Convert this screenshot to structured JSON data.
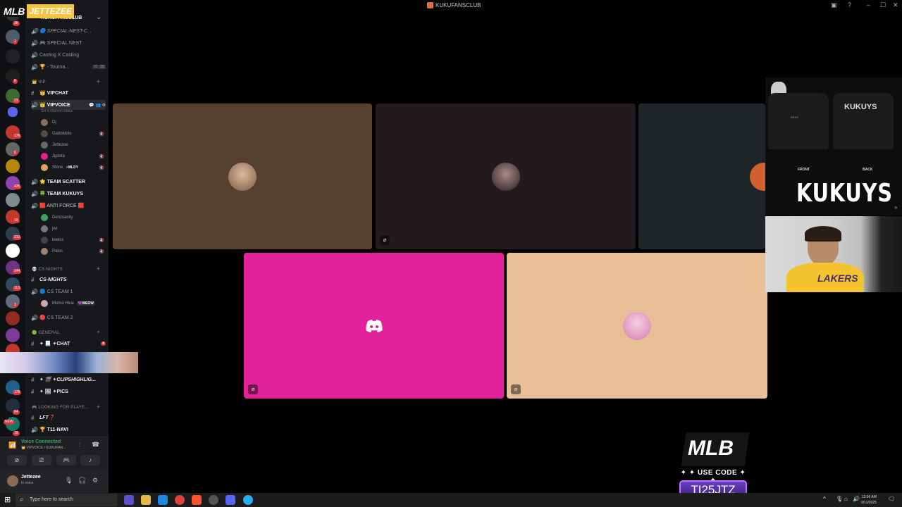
{
  "window": {
    "title": "KUKUFANSCLUB"
  },
  "overlay_logo": {
    "mlb": "MLB",
    "name": "JETTEZEE"
  },
  "server": {
    "name": "KUKUFANSCLUB"
  },
  "channels_top": [
    {
      "label": "🔵 SPECIAL-NEST-C...",
      "icon": "🔊",
      "style": "italic"
    },
    {
      "label": "🎮 SPECIAL NEST",
      "icon": "🔊"
    },
    {
      "label": "Casting X Casting",
      "icon": "🔊"
    },
    {
      "label": "🏆 - Tourna...",
      "icon": "🔊",
      "count_a": "00",
      "count_b": "05"
    }
  ],
  "category_vip": "👑 VIP",
  "vip_chat": "👑 VIPCHAT",
  "vip_voice": "👑 VIPVOICE",
  "channel_status": "Set a channel status",
  "vip_users": [
    {
      "name": "Dj",
      "color": "#8b6e5a"
    },
    {
      "name": "Gabbldoto",
      "color": "#5b4a3c"
    },
    {
      "name": "Jettezee",
      "color": "#6a6a6a"
    },
    {
      "name": "Jgdota",
      "color": "#e91e8c"
    },
    {
      "name": "Shine",
      "color": "#d9a06a",
      "tag": "⚡MLDY"
    }
  ],
  "team_channels": [
    {
      "label": "🌟 TEAM SCATTER"
    },
    {
      "label": "🍀 TEAM KUKUYS"
    },
    {
      "label": "🟥 ANTI FORCE 🟥"
    }
  ],
  "anti_users": [
    {
      "name": "Denzsanity",
      "color": "#3ba55d"
    },
    {
      "name": "jwl",
      "color": "#777"
    },
    {
      "name": "lewiss",
      "color": "#444"
    },
    {
      "name": "Palos",
      "color": "#a08070"
    }
  ],
  "category_cs": "💀 CS NIGHTS",
  "cs_nights": "CS-NIGHTS",
  "cs_team1": "🔵 CS TEAM 1",
  "cs_user": {
    "name": "Momo Hirai",
    "tag": "💜MEOW"
  },
  "cs_team2": "🔴 CS TEAM 2",
  "category_general": "🟢 GENERAL",
  "general_chat": "✦ 📃 ✦CHAT",
  "general_chat_badge": "4",
  "clips": "✦ 🎬 ✦CLIPSHIGHLIG...",
  "pics": "✦ 🖼 ✦PICS",
  "category_lfp": "🎮 LOOKING FOR PLAYE...",
  "lft": "LFT❓",
  "t11": "🏆 T11-NAVI",
  "voice": {
    "status": "Voice Connected",
    "channel": "👑 VIPVOICE / KUKUFAN..."
  },
  "user": {
    "name": "Jettezee",
    "status": "In voice"
  },
  "rail_badges": [
    "36",
    "1",
    "9",
    "23",
    "176",
    "6",
    "425",
    "10",
    "212",
    "244",
    "113",
    "3",
    "178",
    "64",
    "NEW",
    "18"
  ],
  "tiles": [
    {
      "bg": "#56402f",
      "avatar": "#c89a7a"
    },
    {
      "bg": "#231a1e",
      "avatar": "#6b4a45",
      "muted": true
    },
    {
      "bg": "#1d2528",
      "avatar": "#d06030"
    },
    {
      "bg": "#e0239a",
      "discord": true,
      "muted": true
    },
    {
      "bg": "#e9bf98",
      "avatar": "#e7a5c8",
      "muted": true
    }
  ],
  "merch": {
    "front": "FRONT",
    "back": "BACK",
    "brand": "KUKUYS",
    "shirt_text": "KUKUYS"
  },
  "promo": {
    "mlb": "MLB",
    "use_code": "✦ ✦ USE CODE ✦ ✦",
    "code": "TI25JTZ"
  },
  "taskbar": {
    "search": "Type here to search",
    "time": "12:06 AM",
    "date": "9/11/2025"
  },
  "colors": {
    "discord_bg": "#17181b",
    "accent_green": "#3ba55d",
    "badge_red": "#da373c",
    "promo_purple": "#6a3fc0"
  }
}
